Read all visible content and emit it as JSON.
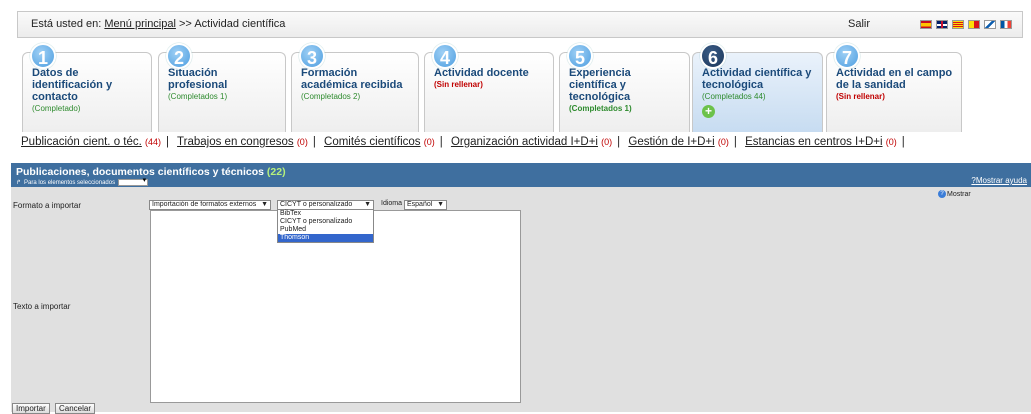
{
  "breadcrumb": {
    "prefix": "Está usted en:",
    "home_link": "Menú principal",
    "separator": ">>",
    "current": "Actividad científica",
    "logout": "Salir"
  },
  "flags": [
    "es",
    "uk",
    "ca",
    "eu",
    "gl",
    "fr"
  ],
  "steps": [
    {
      "num": "1",
      "title": "Datos de identificación y contacto",
      "status": "(Completado)"
    },
    {
      "num": "2",
      "title": "Situación profesional",
      "status": "(Completados 1)"
    },
    {
      "num": "3",
      "title": "Formación académica recibida",
      "status": "(Completados 2)"
    },
    {
      "num": "4",
      "title": "Actividad docente",
      "status": "(Sin rellenar)"
    },
    {
      "num": "5",
      "title": "Experiencia científica y tecnológica",
      "status": "(Completados 1)"
    },
    {
      "num": "6",
      "title": "Actividad científica y tecnológica",
      "status": "(Completados 44)"
    },
    {
      "num": "7",
      "title": "Actividad en el campo de la sanidad",
      "status": "(Sin rellenar)"
    }
  ],
  "sublinks": [
    {
      "label": "Publicación cient. o téc.",
      "count": "(44)"
    },
    {
      "label": "Trabajos en congresos",
      "count": "(0)"
    },
    {
      "label": "Comités científicos",
      "count": "(0)"
    },
    {
      "label": "Organización actividad I+D+i",
      "count": "(0)"
    },
    {
      "label": "Gestión de I+D+i",
      "count": "(0)"
    },
    {
      "label": "Estancias en centros I+D+i",
      "count": "(0)"
    }
  ],
  "panel": {
    "title": "Publicaciones, documentos científicos y técnicos",
    "count": "(22)",
    "selected_label": "Para los elementos seleccionados",
    "help": "Mostrar ayuda",
    "format_label": "Formato a importar",
    "text_label": "Texto a importar",
    "import_type": "Importación de formatos externos",
    "format_value": "CICYT o personalizado",
    "language_label": "Idioma",
    "language_value": "Español",
    "format_options": [
      "BibTex",
      "CICYT o personalizado",
      "PubMed",
      "Thomson"
    ],
    "highlighted_option": "Thomson",
    "show": "Mostrar",
    "import_button": "Importar",
    "cancel_button": "Cancelar"
  }
}
